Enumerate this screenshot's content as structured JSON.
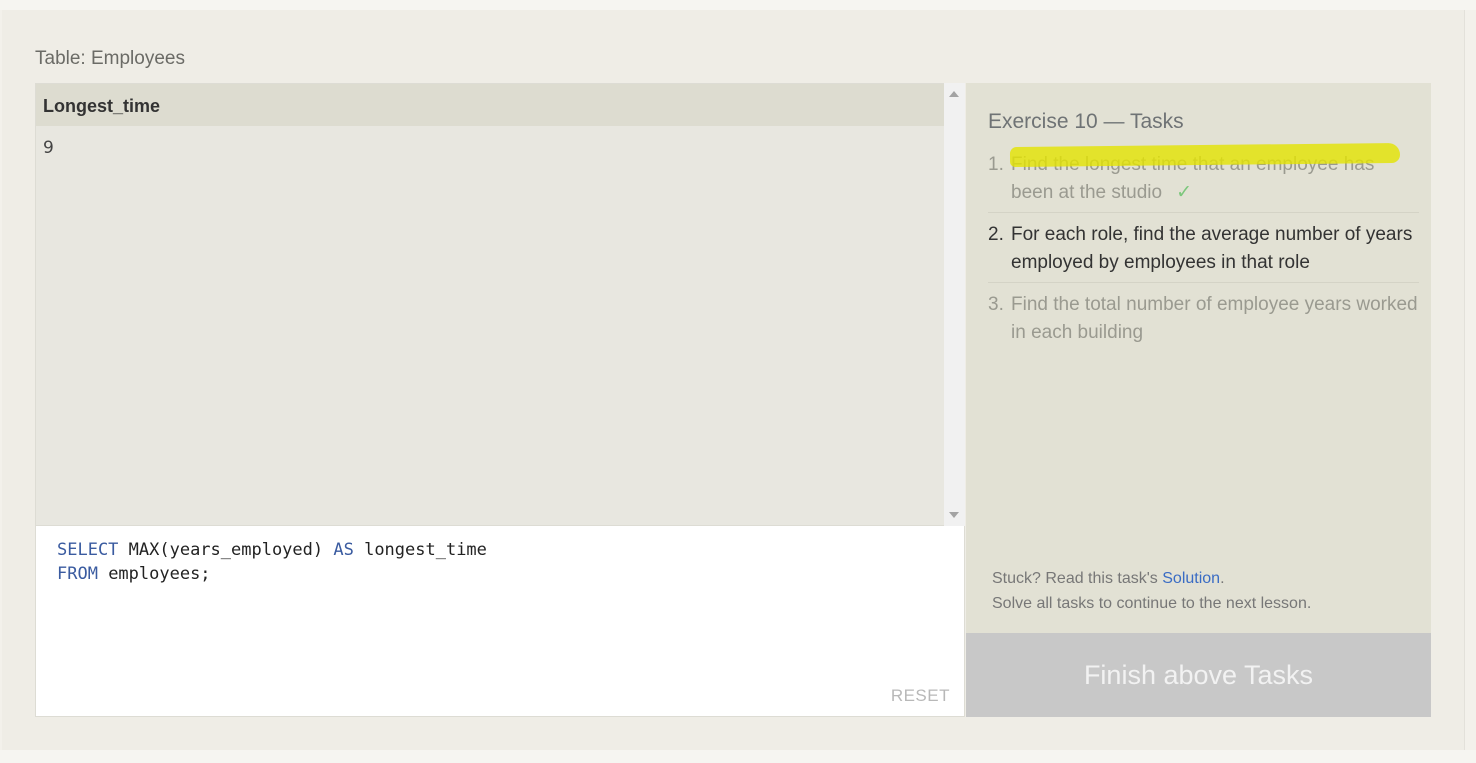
{
  "table_label": "Table: Employees",
  "results": {
    "column_header": "Longest_time",
    "rows": [
      "9"
    ]
  },
  "editor": {
    "line1": {
      "kw1": "SELECT",
      "t1": " MAX(years_employed) ",
      "kw2": "AS",
      "t2": " longest_time"
    },
    "line2": {
      "kw1": "FROM",
      "t1": " employees;"
    },
    "reset_label": "RESET"
  },
  "tasks": {
    "title": "Exercise 10 — Tasks",
    "items": [
      {
        "num": "1.",
        "text": "Find the longest time that an employee has been at the studio",
        "done_mark": "✓"
      },
      {
        "num": "2.",
        "text": "For each role, find the average number of years employed by employees in that role"
      },
      {
        "num": "3.",
        "text": "Find the total number of employee years worked in each building"
      }
    ],
    "stuck_prefix": "Stuck? Read this task's ",
    "solution_link": "Solution",
    "stuck_suffix": ".",
    "continue_text": "Solve all tasks to continue to the next lesson."
  },
  "finish_button": "Finish above Tasks",
  "colors": {
    "highlight": "#e4e400",
    "keyword": "#3a5ba0",
    "link": "#3a6cc4",
    "check": "#7cc77c"
  }
}
